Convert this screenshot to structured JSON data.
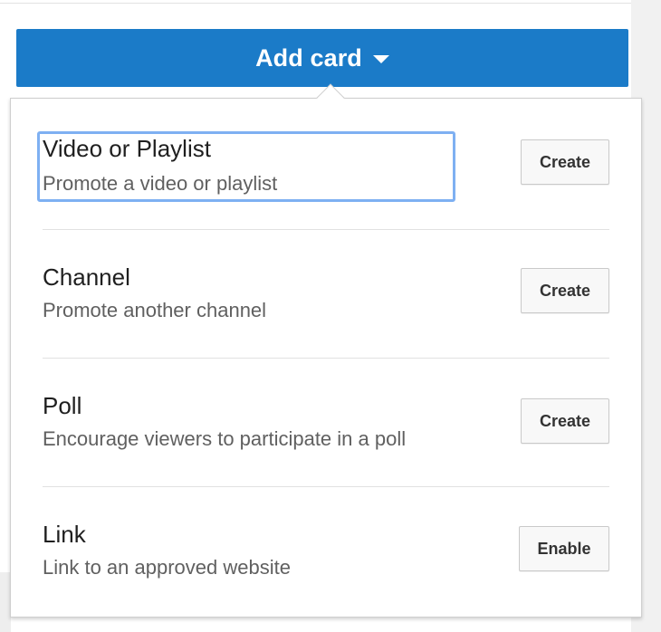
{
  "header": {
    "add_card_label": "Add card"
  },
  "dropdown": {
    "options": [
      {
        "title": "Video or Playlist",
        "description": "Promote a video or playlist",
        "button_label": "Create"
      },
      {
        "title": "Channel",
        "description": "Promote another channel",
        "button_label": "Create"
      },
      {
        "title": "Poll",
        "description": "Encourage viewers to participate in a poll",
        "button_label": "Create"
      },
      {
        "title": "Link",
        "description": "Link to an approved website",
        "button_label": "Enable"
      }
    ]
  },
  "colors": {
    "primary_button": "#1b7bc8",
    "focus_outline": "#7eb0f2"
  },
  "icons": {
    "dropdown_caret": "caret-down-icon"
  }
}
